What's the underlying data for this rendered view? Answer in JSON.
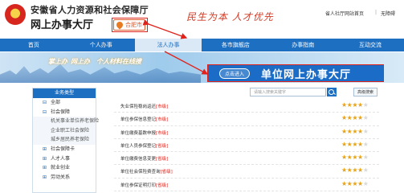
{
  "header": {
    "org_name": "安徽省人力资源和社会保障厅",
    "hall_name": "网上办事大厅",
    "city": "合肥市",
    "slogan": "民生为本  人才优先",
    "top_link": "省人社厅网站首页",
    "top_link_2": "无障碍"
  },
  "nav": [
    "首页",
    "个人办事",
    "法人办事",
    "各市旗舰店",
    "办事指南",
    "互动交流"
  ],
  "banner": {
    "text_1": "掌上办",
    "text_2": "网上办",
    "text_3": "个人材料在线搜",
    "enter_label": "点击进入",
    "title": "单位网上办事大厅"
  },
  "sidebar": {
    "header": "业务类型",
    "items": [
      {
        "sym": "⊟",
        "label": "全部"
      },
      {
        "sym": "⊟",
        "label": "社会保障"
      },
      {
        "sym": "",
        "label": "机关事业单位养老保险"
      },
      {
        "sym": "",
        "label": "企业职工社会保险"
      },
      {
        "sym": "",
        "label": "城乡居民养老保险"
      },
      {
        "sym": "⊞",
        "label": "社会保障卡"
      },
      {
        "sym": "⊞",
        "label": "人才人事"
      },
      {
        "sym": "⊞",
        "label": "就业创业"
      },
      {
        "sym": "⊞",
        "label": "劳动关系"
      }
    ]
  },
  "search": {
    "placeholder": "请输入搜索关键字",
    "advanced": "高级搜索"
  },
  "list": [
    {
      "title": "失业保险稳岗返还",
      "tag": "[市级]",
      "stars": 4
    },
    {
      "title": "单位参保信息登记",
      "tag": "[市级]",
      "stars": 4
    },
    {
      "title": "单位缴费基数申报",
      "tag": "[市级]",
      "stars": 4
    },
    {
      "title": "单位人员参保登记",
      "tag": "[省级]",
      "stars": 4
    },
    {
      "title": "单位缴费信息变更",
      "tag": "[省级]",
      "stars": 4
    },
    {
      "title": "单位社会保险费查询",
      "tag": "[省级]",
      "stars": 4
    },
    {
      "title": "单位参保证明打印",
      "tag": "[省级]",
      "stars": 4
    }
  ]
}
